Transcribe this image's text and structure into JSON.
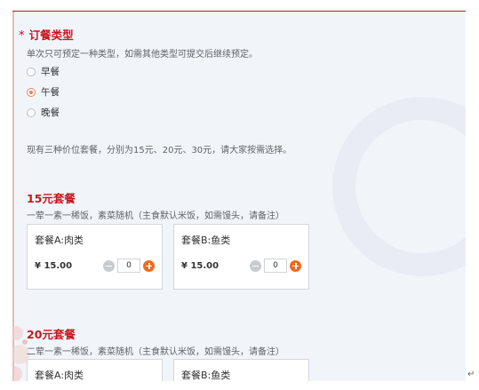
{
  "meal_type": {
    "required_mark": "*",
    "title": "订餐类型",
    "hint": "单次只可预定一种类型，如需其他类型可提交后继续预定。",
    "options": [
      {
        "label": "早餐",
        "checked": false
      },
      {
        "label": "午餐",
        "checked": true
      },
      {
        "label": "晚餐",
        "checked": false
      }
    ]
  },
  "price_note": "现有三种价位套餐，分别为15元、20元、30元，请大家按需选择。",
  "sections": [
    {
      "title": "15元套餐",
      "desc": "一荤一素一稀饭，素菜随机（主食默认米饭，如需馒头，请备注）",
      "items": [
        {
          "name": "套餐A:肉类",
          "price": "¥ 15.00",
          "qty": "0"
        },
        {
          "name": "套餐B:鱼类",
          "price": "¥ 15.00",
          "qty": "0"
        }
      ]
    },
    {
      "title": "20元套餐",
      "desc": "二荤一素一稀饭，素菜随机（主食默认米饭，如需馒头，请备注）",
      "items": [
        {
          "name": "套餐A:肉类"
        },
        {
          "name": "套餐B:鱼类"
        }
      ]
    }
  ],
  "paragraph_mark": "↵",
  "colors": {
    "accent_red": "#c8161d",
    "radio_checked": "#e9835e",
    "plus_orange": "#ef6a1f",
    "panel_bg": "#f1f5fa"
  }
}
